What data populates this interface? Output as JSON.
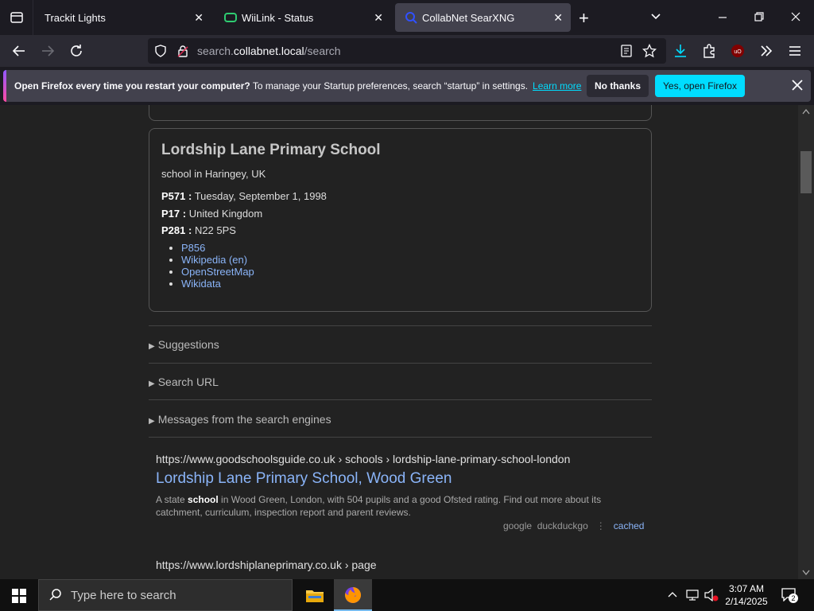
{
  "browser": {
    "tabs": [
      {
        "title": "Trackit Lights",
        "active": false
      },
      {
        "title": "WiiLink - Status",
        "active": false
      },
      {
        "title": "CollabNet SearXNG",
        "active": true
      }
    ],
    "url": {
      "prefix": "search.",
      "host": "collabnet.local",
      "path": "/search"
    }
  },
  "notification": {
    "bold": "Open Firefox every time you restart your computer?",
    "text": " To manage your Startup preferences, search “startup” in settings.",
    "link": "Learn more",
    "dismiss_label": "No thanks",
    "accept_label": "Yes, open Firefox"
  },
  "infobox": {
    "title": "Lordship Lane Primary School",
    "description": "school in Haringey, UK",
    "properties": [
      {
        "key": "P571 :",
        "value": "Tuesday, September 1, 1998"
      },
      {
        "key": "P17 :",
        "value": "United Kingdom"
      },
      {
        "key": "P281 :",
        "value": "N22 5PS"
      }
    ],
    "links": [
      "P856",
      "Wikipedia (en)",
      "OpenStreetMap",
      "Wikidata"
    ]
  },
  "details": [
    "Suggestions",
    "Search URL",
    "Messages from the search engines"
  ],
  "results": [
    {
      "url": "https://www.goodschoolsguide.co.uk",
      "crumbs": " › schools › lordship-lane-primary-school-london",
      "title": "Lordship Lane Primary School, Wood Green",
      "snippet_pre": "A state ",
      "snippet_bold": "school",
      "snippet_post": " in Wood Green, London, with 504 pupils and a good Ofsted rating. Find out more about its catchment, curriculum, inspection report and parent reviews.",
      "engines": "google  duckduckgo",
      "cached": "cached"
    },
    {
      "url": "https://www.lordshiplaneprimary.co.uk",
      "crumbs": " › page"
    }
  ],
  "taskbar": {
    "search_placeholder": "Type here to search",
    "time": "3:07 AM",
    "date": "2/14/2025",
    "notification_count": "2"
  }
}
